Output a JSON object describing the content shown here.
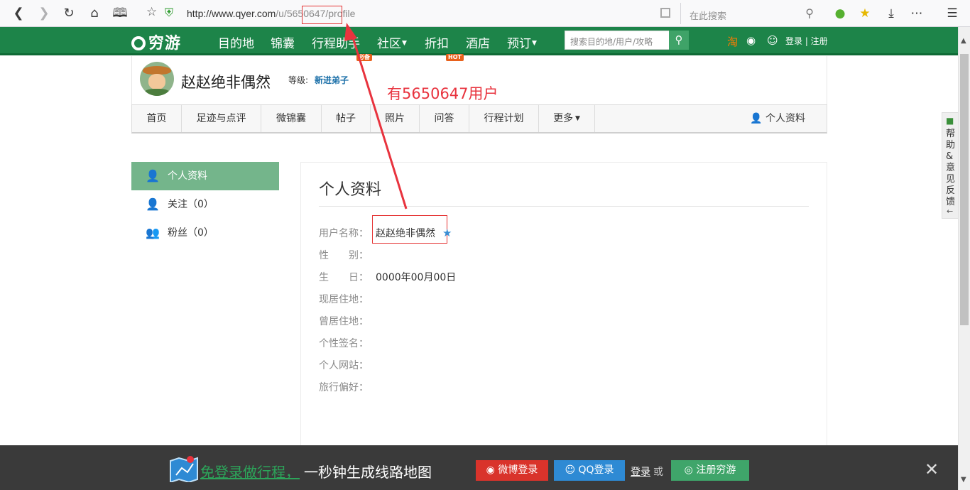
{
  "browser": {
    "url_main": "http://www.qyer.com",
    "url_path_1": "/u/",
    "url_id": "5650647",
    "url_path_2": "/profile",
    "search_placeholder": "在此搜索"
  },
  "site": {
    "logo": "穷游",
    "nav": [
      "目的地",
      "锦囊",
      "行程助手",
      "社区",
      "折扣",
      "酒店",
      "预订"
    ],
    "badge_required": "必备",
    "badge_hot": "HOT",
    "search_placeholder": "搜索目的地/用户/攻略",
    "login_register": "登录 | 注册"
  },
  "profile": {
    "username": "赵赵绝非偶然",
    "level_label": "等级:",
    "level_value": "新进弟子"
  },
  "annotation": "有5650647用户",
  "tabs": [
    "首页",
    "足迹与点评",
    "微锦囊",
    "帖子",
    "照片",
    "问答",
    "行程计划",
    "更多"
  ],
  "tab_profile": "个人资料",
  "left_menu": {
    "profile": "个人资料",
    "follow": "关注（0）",
    "fans": "粉丝（0）"
  },
  "content": {
    "title": "个人资料",
    "fields": [
      {
        "label": "用户名称：",
        "value": "赵赵绝非偶然"
      },
      {
        "label": "性　　别：",
        "value": ""
      },
      {
        "label": "生　　日：",
        "value": "0000年00月00日"
      },
      {
        "label": "现居住地：",
        "value": ""
      },
      {
        "label": "曾居住地：",
        "value": ""
      },
      {
        "label": "个性签名：",
        "value": ""
      },
      {
        "label": "个人网站：",
        "value": ""
      },
      {
        "label": "旅行偏好：",
        "value": ""
      }
    ]
  },
  "help_tab": "帮助&意见反馈",
  "bottom": {
    "slogan_green": "免登录做行程，",
    "slogan_white": "一秒钟生成线路地图",
    "weibo_login": "微博登录",
    "qq_login": "QQ登录",
    "login": "登录",
    "or": "或",
    "register": "注册穷游"
  },
  "colors": {
    "brand_green": "#1d8449",
    "active_menu": "#74b58b",
    "annotation_red": "#e8333e"
  }
}
